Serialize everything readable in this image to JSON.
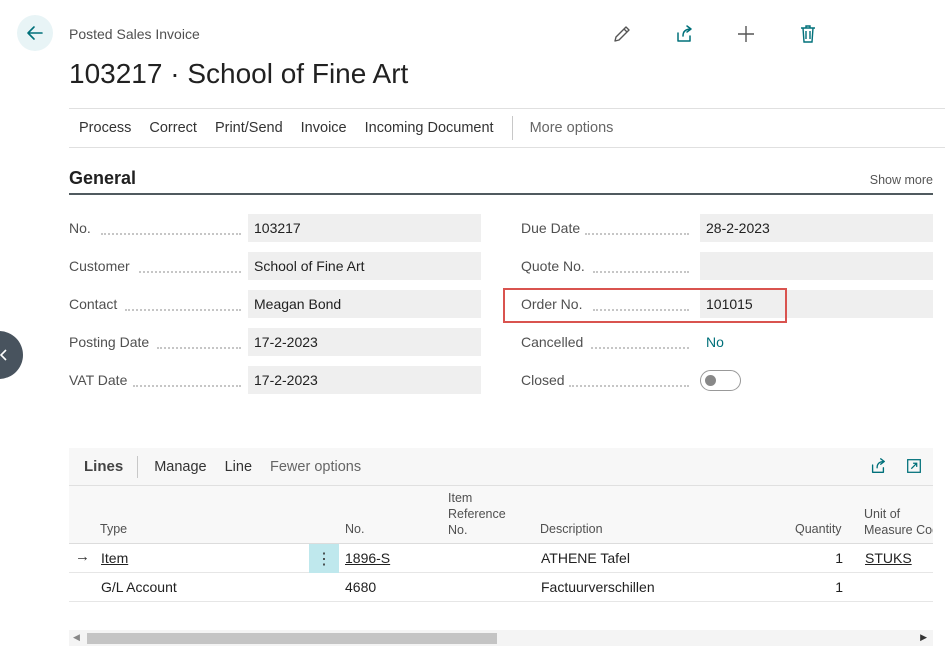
{
  "header": {
    "page_type": "Posted Sales Invoice",
    "title": "103217 · School of Fine Art",
    "icons": [
      "back-arrow-icon",
      "edit-pencil-icon",
      "share-icon",
      "add-plus-icon",
      "delete-trash-icon"
    ]
  },
  "actions": {
    "items": [
      "Process",
      "Correct",
      "Print/Send",
      "Invoice",
      "Incoming Document"
    ],
    "more": "More options"
  },
  "general": {
    "title": "General",
    "show_more": "Show more",
    "left": [
      {
        "label": "No.",
        "value": "103217"
      },
      {
        "label": "Customer",
        "value": "School of Fine Art"
      },
      {
        "label": "Contact",
        "value": "Meagan Bond"
      },
      {
        "label": "Posting Date",
        "value": "17-2-2023"
      },
      {
        "label": "VAT Date",
        "value": "17-2-2023"
      }
    ],
    "right": [
      {
        "label": "Due Date",
        "value": "28-2-2023"
      },
      {
        "label": "Quote No.",
        "value": ""
      },
      {
        "label": "Order No.",
        "value": "101015"
      },
      {
        "label": "Cancelled",
        "value": "No"
      },
      {
        "label": "Closed",
        "value": ""
      }
    ],
    "closed_toggle_on": false
  },
  "lines": {
    "title": "Lines",
    "actions": [
      "Manage",
      "Line"
    ],
    "fewer": "Fewer options",
    "columns": {
      "type": "Type",
      "no": "No.",
      "item_ref_1": "Item",
      "item_ref_2": "Reference",
      "item_ref_3": "No.",
      "description": "Description",
      "quantity": "Quantity",
      "uom_1": "Unit of",
      "uom_2": "Measure Code"
    },
    "rows": [
      {
        "type": "Item",
        "no": "1896-S",
        "description": "ATHENE Tafel",
        "quantity": "1",
        "uom": "STUKS"
      },
      {
        "type": "G/L Account",
        "no": "4680",
        "description": "Factuurverschillen",
        "quantity": "1",
        "uom": ""
      }
    ],
    "current_row_marker": "→",
    "row_menu": "⋮"
  },
  "colors": {
    "accent": "#00707a",
    "highlight": "#d9534f",
    "back_bg": "#e8f4f6",
    "side_tab": "#48535e"
  }
}
